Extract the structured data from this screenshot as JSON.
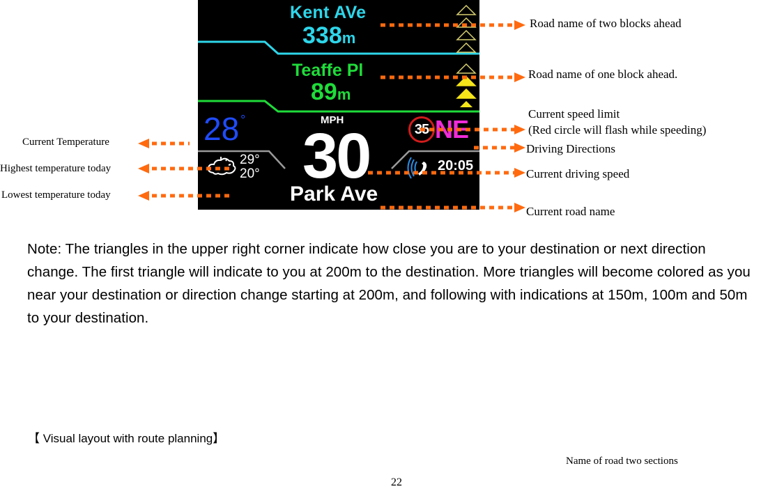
{
  "hud": {
    "road_two_ahead": {
      "name": "Kent AVe",
      "distance": "338",
      "unit": "m"
    },
    "road_one_ahead": {
      "name": "Teaffe Pl",
      "distance": "89",
      "unit": "m"
    },
    "proximity_triangles": {
      "total": 8,
      "filled": 3
    },
    "current_temperature": "28",
    "temperature_degree_symbol": "°",
    "high_temperature": "29°",
    "low_temperature": "20°",
    "weather_icon": "partly-cloudy-icon",
    "speed_unit": "MPH",
    "current_speed": "30",
    "current_road": "Park Ave",
    "speed_limit": "35",
    "direction": "NE",
    "phone_icon": "bluetooth-phone-icon",
    "clock": "20:05",
    "colors": {
      "road_two": "#2ed6ea",
      "road_one": "#1fdc3a",
      "temperature": "#1f4cff",
      "direction": "#f02bd8",
      "speed_limit_ring": "#d21c1c",
      "triangle": "#f5e61a",
      "annotation_arrow": "#ff6a0f"
    }
  },
  "annotations": {
    "road_two_ahead": "Road name of two blocks ahead",
    "road_one_ahead": "Road name of one block ahead.",
    "speed_limit_line1": "Current speed limit",
    "speed_limit_line2": "(Red circle will flash while speeding)",
    "driving_directions": "Driving Directions",
    "current_speed": "Current driving speed",
    "current_road": "Current road name",
    "current_temperature": "Current Temperature",
    "high_temperature": "Highest temperature today",
    "low_temperature": "Lowest temperature today"
  },
  "note": "Note: The triangles in the upper right corner indicate how close you are to your destination or next direction change.    The first triangle will indicate to you at 200m to the destination.    More triangles will become colored as you near your destination or direction change starting at 200m, and following with indications at 150m, 100m and 50m to your destination.",
  "section_heading": "【  Visual layout with route planning】",
  "caption": "Name of road two sections",
  "page_number": "22"
}
